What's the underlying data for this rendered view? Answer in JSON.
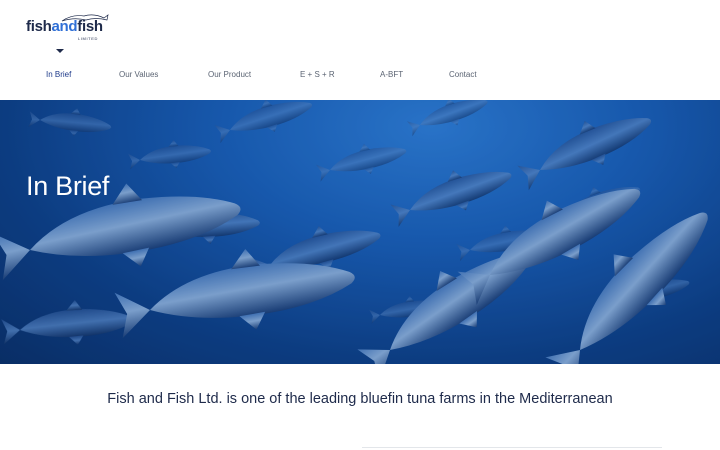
{
  "brand": {
    "name_part1": "fish",
    "name_part2": "and",
    "name_part3": "fish",
    "subtitle": "LIMITED"
  },
  "nav": {
    "items": [
      {
        "label": "In Brief",
        "active": true
      },
      {
        "label": "Our Values",
        "active": false
      },
      {
        "label": "Our Product",
        "active": false
      },
      {
        "label": "E + S + R",
        "active": false
      },
      {
        "label": "A-BFT",
        "active": false
      },
      {
        "label": "Contact",
        "active": false
      }
    ]
  },
  "hero": {
    "title": "In Brief",
    "image": "bluefin-tuna-school-underwater"
  },
  "intro": {
    "tagline": "Fish and Fish Ltd. is one of the leading bluefin tuna farms in the Mediterranean"
  },
  "colors": {
    "brand_navy": "#1e2a4a",
    "brand_blue": "#2f6fd6",
    "nav_text": "#5b6473",
    "ocean": "#1a5fb8"
  }
}
